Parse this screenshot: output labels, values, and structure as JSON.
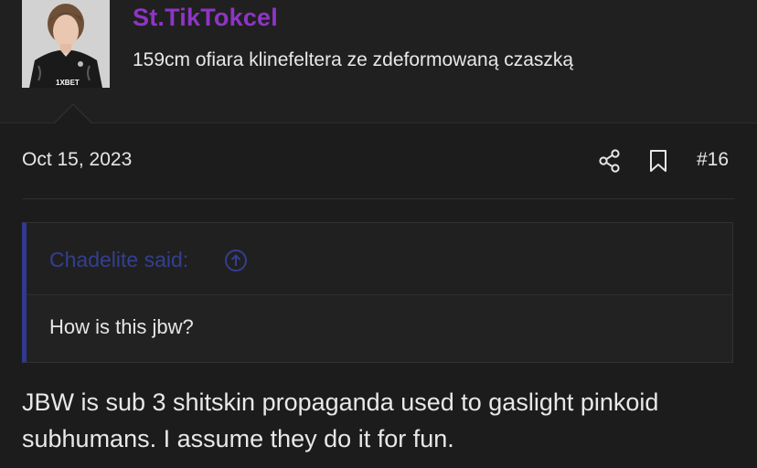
{
  "user": {
    "name": "St.TikTokcel",
    "title": "159cm ofiara klinefeltera ze zdeformowaną czaszką",
    "avatar_jersey_text": "1XBET"
  },
  "post": {
    "date": "Oct 15, 2023",
    "number": "#16",
    "icons": [
      "share-icon",
      "bookmark-icon"
    ]
  },
  "quote": {
    "author_line": "Chadelite said:",
    "text": "How is this jbw?",
    "icon": "arrow-up-circle-icon"
  },
  "message": {
    "text": "JBW is sub 3 shitskin propaganda used to gaslight pinkoid subhumans. I assume they do it for fun."
  },
  "colors": {
    "background": "#1c1c1c",
    "username": "#8e35c6",
    "quote_accent": "#2f3a8f",
    "quote_author": "#343f8f"
  }
}
